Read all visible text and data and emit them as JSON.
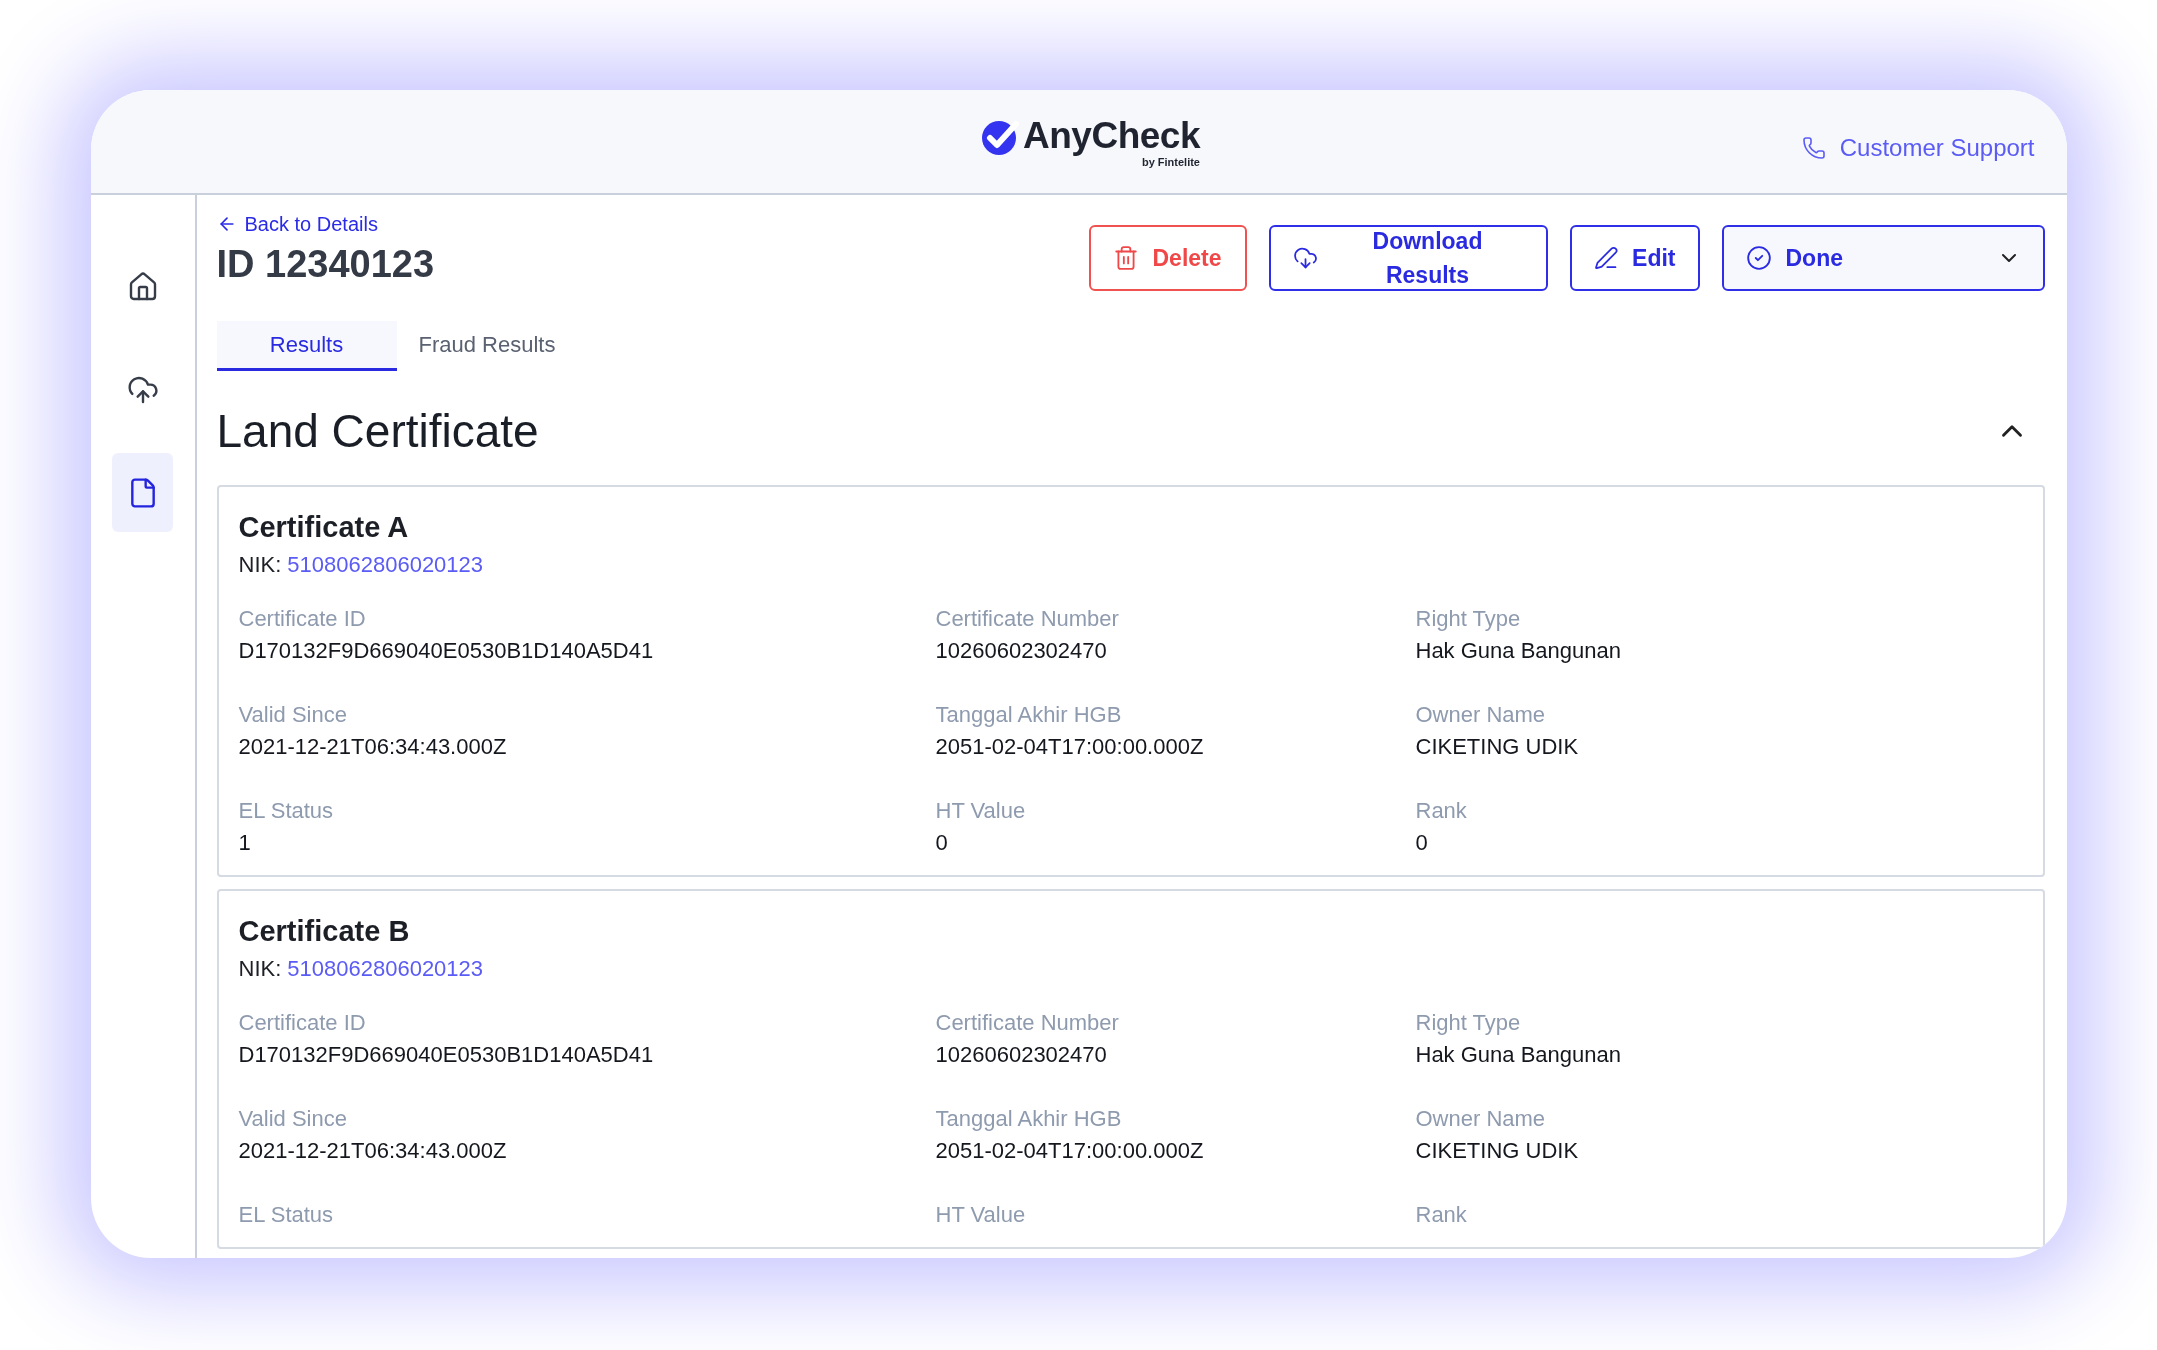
{
  "header": {
    "logo": {
      "name": "AnyCheck",
      "byline": "by Fintelite"
    },
    "support_link": "Customer Support"
  },
  "sidebar": {
    "items": [
      {
        "kind": "home",
        "selected": false
      },
      {
        "kind": "upload",
        "selected": false
      },
      {
        "kind": "document",
        "selected": true
      }
    ]
  },
  "back_link": "Back to Details",
  "title": "ID 12340123",
  "actions": [
    {
      "kind": "delete",
      "label": "Delete"
    },
    {
      "kind": "download",
      "label": "Download Results"
    },
    {
      "kind": "edit",
      "label": "Edit"
    },
    {
      "kind": "status",
      "label": "Done"
    }
  ],
  "tabs": [
    {
      "label": "Results",
      "selected": true
    },
    {
      "label": "Fraud Results",
      "selected": false
    }
  ],
  "section": {
    "title": "Land Certificate",
    "expanded": true
  },
  "certificates": [
    {
      "name": "Certificate A",
      "nik_label": "NIK:",
      "nik": "5108062806020123",
      "fields": [
        {
          "label": "Certificate ID",
          "value": "D170132F9D669040E0530B1D140A5D41"
        },
        {
          "label": "Certificate Number",
          "value": "10260602302470"
        },
        {
          "label": "Right Type",
          "value": "Hak Guna Bangunan"
        },
        {
          "label": "Valid Since",
          "value": "2021-12-21T06:34:43.000Z"
        },
        {
          "label": "Tanggal Akhir HGB",
          "value": "2051-02-04T17:00:00.000Z"
        },
        {
          "label": "Owner Name",
          "value": "CIKETING UDIK"
        },
        {
          "label": "EL Status",
          "value": "1"
        },
        {
          "label": "HT Value",
          "value": "0"
        },
        {
          "label": "Rank",
          "value": "0"
        }
      ]
    },
    {
      "name": "Certificate B",
      "nik_label": "NIK:",
      "nik": "5108062806020123",
      "fields": [
        {
          "label": "Certificate ID",
          "value": "D170132F9D669040E0530B1D140A5D41"
        },
        {
          "label": "Certificate Number",
          "value": "10260602302470"
        },
        {
          "label": "Right Type",
          "value": "Hak Guna Bangunan"
        },
        {
          "label": "Valid Since",
          "value": "2021-12-21T06:34:43.000Z"
        },
        {
          "label": "Tanggal Akhir HGB",
          "value": "2051-02-04T17:00:00.000Z"
        },
        {
          "label": "Owner Name",
          "value": "CIKETING UDIK"
        },
        {
          "label": "EL Status"
        },
        {
          "label": "HT Value"
        },
        {
          "label": "Rank"
        }
      ]
    }
  ]
}
